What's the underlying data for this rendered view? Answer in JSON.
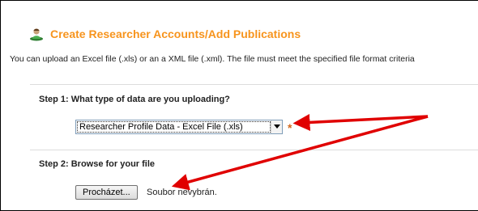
{
  "header": {
    "title": "Create Researcher Accounts/Add Publications",
    "icon": "user-add-icon"
  },
  "description": "You can upload an Excel file (.xls) or an a XML file (.xml). The file must meet the specified file format criteria",
  "step1": {
    "label": "Step 1: What type of data are you uploading?",
    "select_value": "Researcher Profile Data - Excel File (.xls)",
    "required_mark": "*"
  },
  "step2": {
    "label": "Step 2: Browse for your file",
    "browse_button": "Procházet...",
    "no_file_text": "Soubor nevybrán."
  },
  "colors": {
    "title": "#f7941d",
    "annotation_arrow": "#e00000"
  }
}
